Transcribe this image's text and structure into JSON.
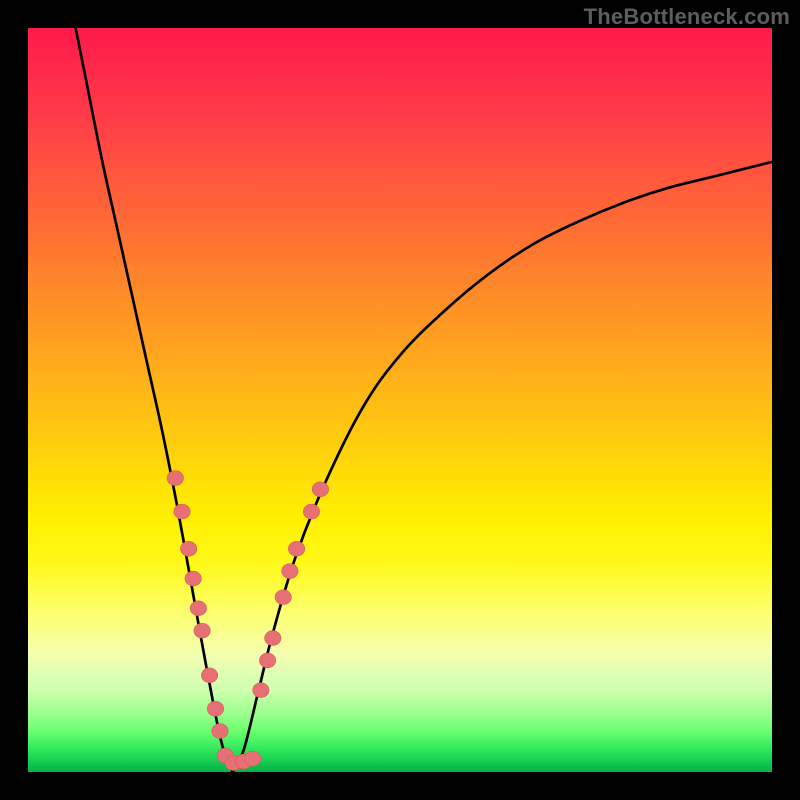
{
  "watermark": "TheBottleneck.com",
  "chart_data": {
    "type": "line",
    "title": "",
    "xlabel": "",
    "ylabel": "",
    "xlim": [
      0,
      100
    ],
    "ylim": [
      0,
      100
    ],
    "curve": {
      "minimum_x": 27.5,
      "left_branch": [
        {
          "x": 6.4,
          "y": 100
        },
        {
          "x": 8,
          "y": 92
        },
        {
          "x": 10,
          "y": 82
        },
        {
          "x": 12,
          "y": 73
        },
        {
          "x": 14,
          "y": 64
        },
        {
          "x": 16,
          "y": 55
        },
        {
          "x": 18,
          "y": 46
        },
        {
          "x": 20,
          "y": 36
        },
        {
          "x": 22,
          "y": 25
        },
        {
          "x": 24,
          "y": 14
        },
        {
          "x": 26,
          "y": 4
        },
        {
          "x": 27.5,
          "y": 0
        }
      ],
      "right_branch": [
        {
          "x": 27.5,
          "y": 0
        },
        {
          "x": 29,
          "y": 3
        },
        {
          "x": 31,
          "y": 11
        },
        {
          "x": 33,
          "y": 19
        },
        {
          "x": 36,
          "y": 29
        },
        {
          "x": 40,
          "y": 39
        },
        {
          "x": 45,
          "y": 49
        },
        {
          "x": 50,
          "y": 56
        },
        {
          "x": 56,
          "y": 62
        },
        {
          "x": 62,
          "y": 67
        },
        {
          "x": 68,
          "y": 71
        },
        {
          "x": 74,
          "y": 74
        },
        {
          "x": 80,
          "y": 76.5
        },
        {
          "x": 86,
          "y": 78.5
        },
        {
          "x": 92,
          "y": 80
        },
        {
          "x": 100,
          "y": 82
        }
      ]
    },
    "markers": [
      {
        "x": 19.8,
        "y": 39.5
      },
      {
        "x": 20.7,
        "y": 35
      },
      {
        "x": 21.6,
        "y": 30
      },
      {
        "x": 22.2,
        "y": 26
      },
      {
        "x": 22.9,
        "y": 22
      },
      {
        "x": 23.4,
        "y": 19
      },
      {
        "x": 24.4,
        "y": 13
      },
      {
        "x": 25.2,
        "y": 8.5
      },
      {
        "x": 25.8,
        "y": 5.5
      },
      {
        "x": 26.5,
        "y": 2.2
      },
      {
        "x": 27.6,
        "y": 1.2
      },
      {
        "x": 29.0,
        "y": 1.4
      },
      {
        "x": 30.2,
        "y": 1.8
      },
      {
        "x": 31.3,
        "y": 11
      },
      {
        "x": 32.2,
        "y": 15
      },
      {
        "x": 32.9,
        "y": 18
      },
      {
        "x": 34.3,
        "y": 23.5
      },
      {
        "x": 35.2,
        "y": 27
      },
      {
        "x": 36.1,
        "y": 30
      },
      {
        "x": 38.1,
        "y": 35
      },
      {
        "x": 39.3,
        "y": 38
      }
    ],
    "color_scale": {
      "top": "#ff1a4a",
      "mid": "#fff000",
      "bottom": "#07b048"
    }
  }
}
